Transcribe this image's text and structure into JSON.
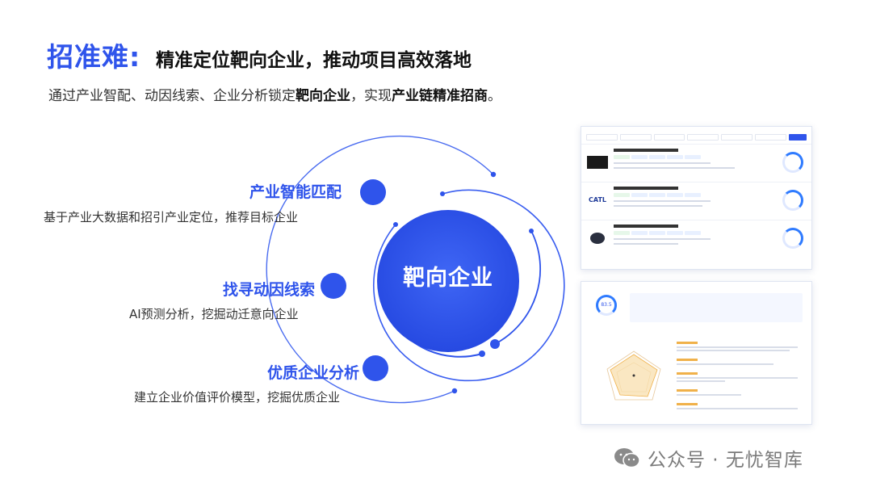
{
  "header": {
    "keyword": "招准难:",
    "title": "精准定位靶向企业，推动项目高效落地"
  },
  "subtitle": {
    "part1": "通过产业智配、动因线索、企业分析锁定",
    "bold1": "靶向企业",
    "part2": "，实现",
    "bold2": "产业链精准招商",
    "part3": "。"
  },
  "center": {
    "label": "靶向企业"
  },
  "features": [
    {
      "title": "产业智能匹配",
      "desc": "基于产业大数据和招引产业定位，推荐目标企业"
    },
    {
      "title": "找寻动因线索",
      "desc": "AI预测分析，挖掘动迁意向企业"
    },
    {
      "title": "优质企业分析",
      "desc": "建立企业价值评价模型，挖掘优质企业"
    }
  ],
  "colors": {
    "accent": "#2f54eb",
    "circle": "#2f54eb"
  },
  "screenshot_a": {
    "logos": [
      "CATL"
    ],
    "score_label": "83.5"
  },
  "watermark": {
    "text": "公众号 · 无忧智库",
    "icon": "wechat-icon"
  }
}
